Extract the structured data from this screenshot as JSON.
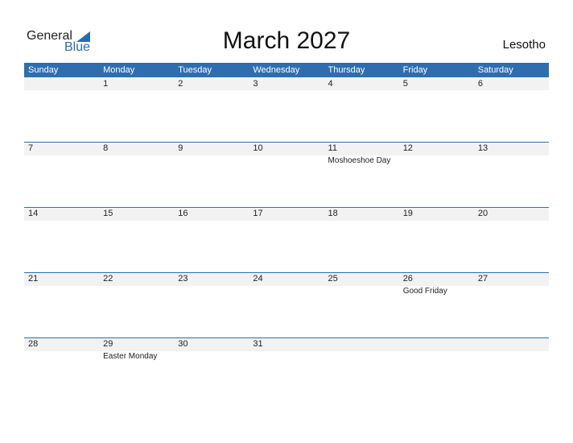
{
  "logo": {
    "line1": "General",
    "line2": "Blue"
  },
  "title": "March 2027",
  "country": "Lesotho",
  "colors": {
    "accent": "#2e6eb0",
    "strip": "#f2f2f2"
  },
  "weekdays": [
    "Sunday",
    "Monday",
    "Tuesday",
    "Wednesday",
    "Thursday",
    "Friday",
    "Saturday"
  ],
  "weeks": [
    [
      {
        "d": ""
      },
      {
        "d": "1"
      },
      {
        "d": "2"
      },
      {
        "d": "3"
      },
      {
        "d": "4"
      },
      {
        "d": "5"
      },
      {
        "d": "6"
      }
    ],
    [
      {
        "d": "7"
      },
      {
        "d": "8"
      },
      {
        "d": "9"
      },
      {
        "d": "10"
      },
      {
        "d": "11",
        "h": "Moshoeshoe Day"
      },
      {
        "d": "12"
      },
      {
        "d": "13"
      }
    ],
    [
      {
        "d": "14"
      },
      {
        "d": "15"
      },
      {
        "d": "16"
      },
      {
        "d": "17"
      },
      {
        "d": "18"
      },
      {
        "d": "19"
      },
      {
        "d": "20"
      }
    ],
    [
      {
        "d": "21"
      },
      {
        "d": "22"
      },
      {
        "d": "23"
      },
      {
        "d": "24"
      },
      {
        "d": "25"
      },
      {
        "d": "26",
        "h": "Good Friday"
      },
      {
        "d": "27"
      }
    ],
    [
      {
        "d": "28"
      },
      {
        "d": "29",
        "h": "Easter Monday"
      },
      {
        "d": "30"
      },
      {
        "d": "31"
      },
      {
        "d": ""
      },
      {
        "d": ""
      },
      {
        "d": ""
      }
    ]
  ]
}
